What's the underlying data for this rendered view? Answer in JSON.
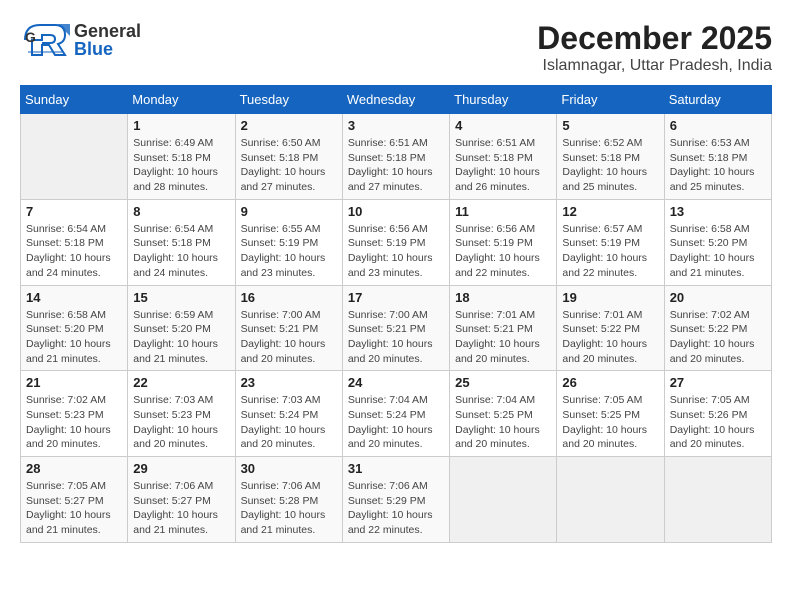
{
  "header": {
    "logo_general": "General",
    "logo_blue": "Blue",
    "month_year": "December 2025",
    "location": "Islamnagar, Uttar Pradesh, India"
  },
  "calendar": {
    "days_of_week": [
      "Sunday",
      "Monday",
      "Tuesday",
      "Wednesday",
      "Thursday",
      "Friday",
      "Saturday"
    ],
    "weeks": [
      [
        {
          "day": "",
          "info": ""
        },
        {
          "day": "1",
          "info": "Sunrise: 6:49 AM\nSunset: 5:18 PM\nDaylight: 10 hours\nand 28 minutes."
        },
        {
          "day": "2",
          "info": "Sunrise: 6:50 AM\nSunset: 5:18 PM\nDaylight: 10 hours\nand 27 minutes."
        },
        {
          "day": "3",
          "info": "Sunrise: 6:51 AM\nSunset: 5:18 PM\nDaylight: 10 hours\nand 27 minutes."
        },
        {
          "day": "4",
          "info": "Sunrise: 6:51 AM\nSunset: 5:18 PM\nDaylight: 10 hours\nand 26 minutes."
        },
        {
          "day": "5",
          "info": "Sunrise: 6:52 AM\nSunset: 5:18 PM\nDaylight: 10 hours\nand 25 minutes."
        },
        {
          "day": "6",
          "info": "Sunrise: 6:53 AM\nSunset: 5:18 PM\nDaylight: 10 hours\nand 25 minutes."
        }
      ],
      [
        {
          "day": "7",
          "info": "Sunrise: 6:54 AM\nSunset: 5:18 PM\nDaylight: 10 hours\nand 24 minutes."
        },
        {
          "day": "8",
          "info": "Sunrise: 6:54 AM\nSunset: 5:18 PM\nDaylight: 10 hours\nand 24 minutes."
        },
        {
          "day": "9",
          "info": "Sunrise: 6:55 AM\nSunset: 5:19 PM\nDaylight: 10 hours\nand 23 minutes."
        },
        {
          "day": "10",
          "info": "Sunrise: 6:56 AM\nSunset: 5:19 PM\nDaylight: 10 hours\nand 23 minutes."
        },
        {
          "day": "11",
          "info": "Sunrise: 6:56 AM\nSunset: 5:19 PM\nDaylight: 10 hours\nand 22 minutes."
        },
        {
          "day": "12",
          "info": "Sunrise: 6:57 AM\nSunset: 5:19 PM\nDaylight: 10 hours\nand 22 minutes."
        },
        {
          "day": "13",
          "info": "Sunrise: 6:58 AM\nSunset: 5:20 PM\nDaylight: 10 hours\nand 21 minutes."
        }
      ],
      [
        {
          "day": "14",
          "info": "Sunrise: 6:58 AM\nSunset: 5:20 PM\nDaylight: 10 hours\nand 21 minutes."
        },
        {
          "day": "15",
          "info": "Sunrise: 6:59 AM\nSunset: 5:20 PM\nDaylight: 10 hours\nand 21 minutes."
        },
        {
          "day": "16",
          "info": "Sunrise: 7:00 AM\nSunset: 5:21 PM\nDaylight: 10 hours\nand 20 minutes."
        },
        {
          "day": "17",
          "info": "Sunrise: 7:00 AM\nSunset: 5:21 PM\nDaylight: 10 hours\nand 20 minutes."
        },
        {
          "day": "18",
          "info": "Sunrise: 7:01 AM\nSunset: 5:21 PM\nDaylight: 10 hours\nand 20 minutes."
        },
        {
          "day": "19",
          "info": "Sunrise: 7:01 AM\nSunset: 5:22 PM\nDaylight: 10 hours\nand 20 minutes."
        },
        {
          "day": "20",
          "info": "Sunrise: 7:02 AM\nSunset: 5:22 PM\nDaylight: 10 hours\nand 20 minutes."
        }
      ],
      [
        {
          "day": "21",
          "info": "Sunrise: 7:02 AM\nSunset: 5:23 PM\nDaylight: 10 hours\nand 20 minutes."
        },
        {
          "day": "22",
          "info": "Sunrise: 7:03 AM\nSunset: 5:23 PM\nDaylight: 10 hours\nand 20 minutes."
        },
        {
          "day": "23",
          "info": "Sunrise: 7:03 AM\nSunset: 5:24 PM\nDaylight: 10 hours\nand 20 minutes."
        },
        {
          "day": "24",
          "info": "Sunrise: 7:04 AM\nSunset: 5:24 PM\nDaylight: 10 hours\nand 20 minutes."
        },
        {
          "day": "25",
          "info": "Sunrise: 7:04 AM\nSunset: 5:25 PM\nDaylight: 10 hours\nand 20 minutes."
        },
        {
          "day": "26",
          "info": "Sunrise: 7:05 AM\nSunset: 5:25 PM\nDaylight: 10 hours\nand 20 minutes."
        },
        {
          "day": "27",
          "info": "Sunrise: 7:05 AM\nSunset: 5:26 PM\nDaylight: 10 hours\nand 20 minutes."
        }
      ],
      [
        {
          "day": "28",
          "info": "Sunrise: 7:05 AM\nSunset: 5:27 PM\nDaylight: 10 hours\nand 21 minutes."
        },
        {
          "day": "29",
          "info": "Sunrise: 7:06 AM\nSunset: 5:27 PM\nDaylight: 10 hours\nand 21 minutes."
        },
        {
          "day": "30",
          "info": "Sunrise: 7:06 AM\nSunset: 5:28 PM\nDaylight: 10 hours\nand 21 minutes."
        },
        {
          "day": "31",
          "info": "Sunrise: 7:06 AM\nSunset: 5:29 PM\nDaylight: 10 hours\nand 22 minutes."
        },
        {
          "day": "",
          "info": ""
        },
        {
          "day": "",
          "info": ""
        },
        {
          "day": "",
          "info": ""
        }
      ]
    ]
  }
}
